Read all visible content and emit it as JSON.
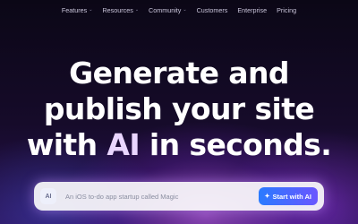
{
  "nav": {
    "items": [
      {
        "label": "Features",
        "has_dropdown": true
      },
      {
        "label": "Resources",
        "has_dropdown": true
      },
      {
        "label": "Community",
        "has_dropdown": true
      },
      {
        "label": "Customers",
        "has_dropdown": false
      },
      {
        "label": "Enterprise",
        "has_dropdown": false
      },
      {
        "label": "Pricing",
        "has_dropdown": false
      }
    ],
    "dropdown_glyph": "⌄"
  },
  "hero": {
    "line1": "Generate and",
    "line2": "publish your site",
    "line3_start": "with ",
    "line3_ai": "AI",
    "line3_end": " in seconds."
  },
  "prompt": {
    "badge": "AI",
    "placeholder": "An iOS to-do app startup called Magic",
    "button_label": "Start with AI",
    "button_icon": "sparkle-icon"
  },
  "colors": {
    "background": "#0c0718",
    "glow": "#d66eff",
    "button_start": "#2a7bff",
    "button_end": "#6a55ff"
  }
}
